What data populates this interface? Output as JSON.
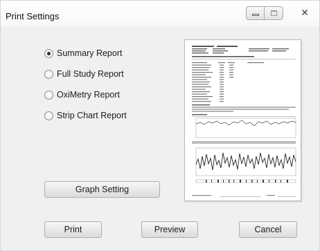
{
  "window": {
    "title": "Print Settings",
    "close_glyph": "✕"
  },
  "report_options": [
    {
      "label": "Summary Report",
      "checked": true
    },
    {
      "label": "Full Study Report",
      "checked": false
    },
    {
      "label": "OxiMetry Report",
      "checked": false
    },
    {
      "label": "Strip Chart Report",
      "checked": false
    }
  ],
  "buttons": {
    "graph_setting": "Graph Setting",
    "print": "Print",
    "preview": "Preview",
    "cancel": "Cancel"
  },
  "icons": {
    "minimize": "minimize-icon",
    "maximize": "maximize-icon",
    "close": "close-icon"
  }
}
